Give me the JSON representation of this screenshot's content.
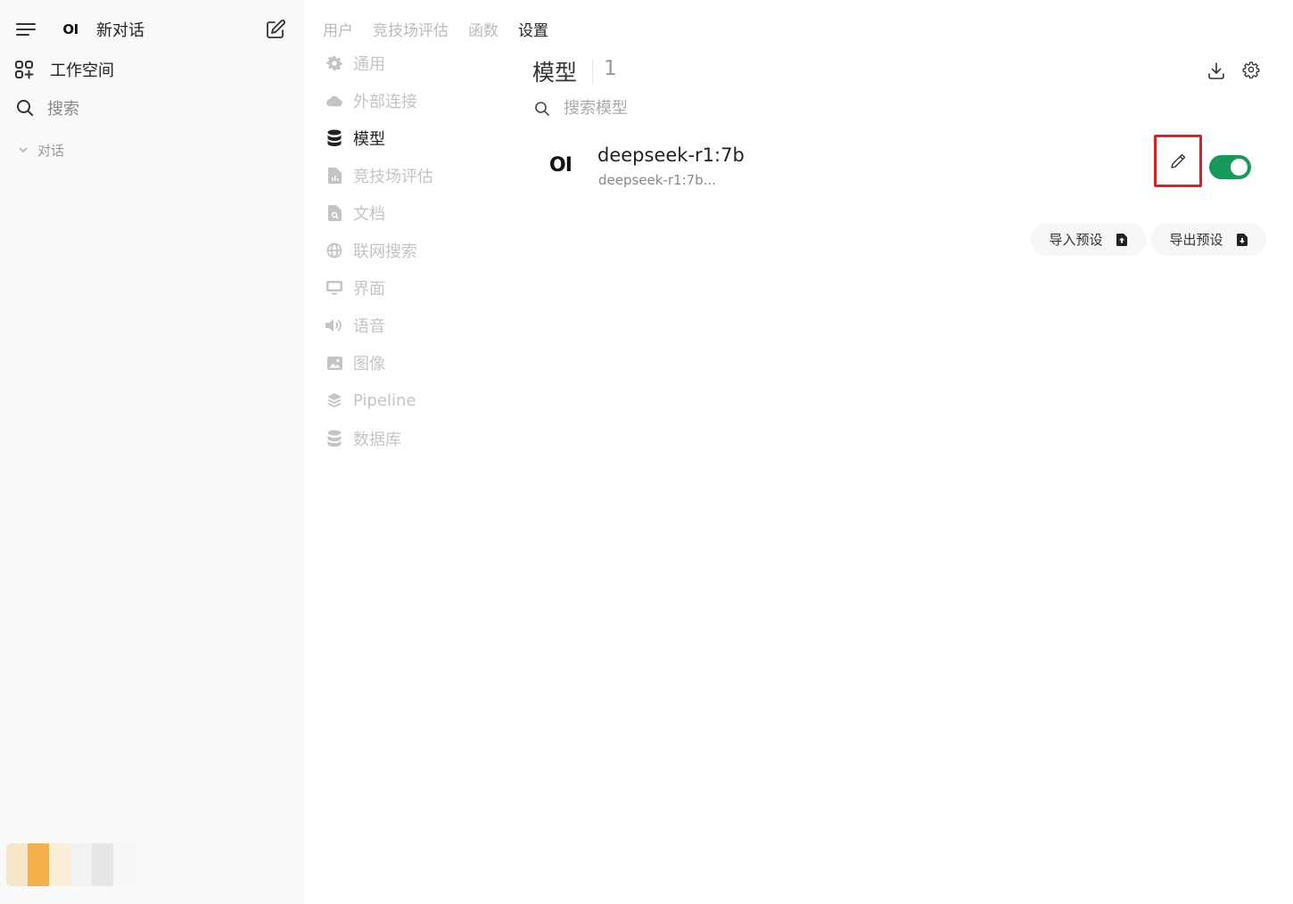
{
  "sidebar": {
    "new_chat_label": "新对话",
    "workspace_label": "工作空间",
    "search_label": "搜索",
    "conversations_label": "对话",
    "logo_text": "OI",
    "avatar_colors": [
      "#f8e6c8",
      "#f4b04a",
      "#fbeed6",
      "#f2f2f2",
      "#e6e6e6",
      "#f7f7f7"
    ]
  },
  "top_tabs": [
    {
      "label": "用户",
      "active": false
    },
    {
      "label": "竞技场评估",
      "active": false
    },
    {
      "label": "函数",
      "active": false
    },
    {
      "label": "设置",
      "active": true
    }
  ],
  "settings_nav": [
    {
      "label": "通用",
      "icon": "gear-icon",
      "active": false
    },
    {
      "label": "外部连接",
      "icon": "cloud-icon",
      "active": false
    },
    {
      "label": "模型",
      "icon": "database-icon",
      "active": true
    },
    {
      "label": "竞技场评估",
      "icon": "document-chart-icon",
      "active": false
    },
    {
      "label": "文档",
      "icon": "document-search-icon",
      "active": false
    },
    {
      "label": "联网搜索",
      "icon": "globe-icon",
      "active": false
    },
    {
      "label": "界面",
      "icon": "monitor-icon",
      "active": false
    },
    {
      "label": "语音",
      "icon": "speaker-icon",
      "active": false
    },
    {
      "label": "图像",
      "icon": "image-icon",
      "active": false
    },
    {
      "label": "Pipeline",
      "icon": "layers-icon",
      "active": false
    },
    {
      "label": "数据库",
      "icon": "database-icon",
      "active": false
    }
  ],
  "main": {
    "title": "模型",
    "count": "1",
    "search_placeholder": "搜索模型",
    "models": [
      {
        "name": "deepseek-r1:7b",
        "subtitle": "deepseek-r1:7b...",
        "logo": "OI",
        "enabled": true
      }
    ],
    "import_label": "导入预设",
    "export_label": "导出预设"
  },
  "colors": {
    "toggle_on": "#17995a",
    "highlight_box": "#e02020",
    "sidebar_bg": "#f9f9f9"
  }
}
